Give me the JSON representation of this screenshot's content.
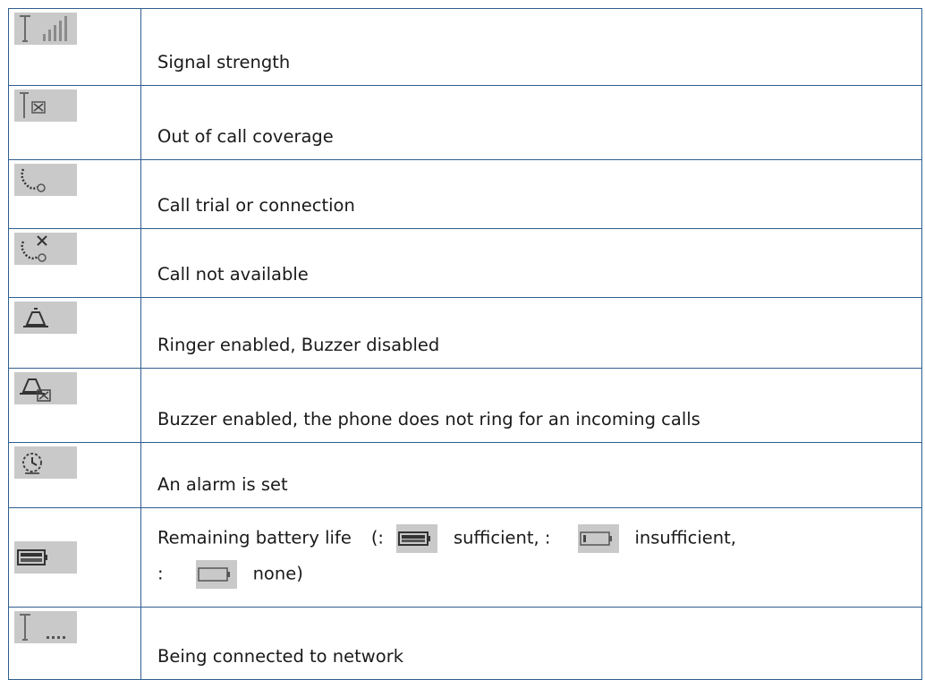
{
  "rows": [
    {
      "icon": "signal-strength-icon",
      "text": "Signal strength"
    },
    {
      "icon": "out-of-coverage-icon",
      "text": "Out of call coverage"
    },
    {
      "icon": "call-connection-icon",
      "text": "Call trial or connection"
    },
    {
      "icon": "call-not-available-icon",
      "text": "Call not available"
    },
    {
      "icon": "ringer-enabled-icon",
      "text": "Ringer enabled, Buzzer disabled"
    },
    {
      "icon": "buzzer-enabled-icon",
      "text": "Buzzer enabled, the phone does not ring for an incoming calls"
    },
    {
      "icon": "alarm-set-icon",
      "text": "An alarm is set"
    },
    {
      "icon": "battery-icon",
      "battery": {
        "label": "Remaining battery life",
        "open": "(:",
        "sufficient": "sufficient, :",
        "insufficient": "insufficient,",
        "colon": ":",
        "none": "none)"
      }
    },
    {
      "icon": "network-connecting-icon",
      "text": "Being connected to network"
    }
  ]
}
